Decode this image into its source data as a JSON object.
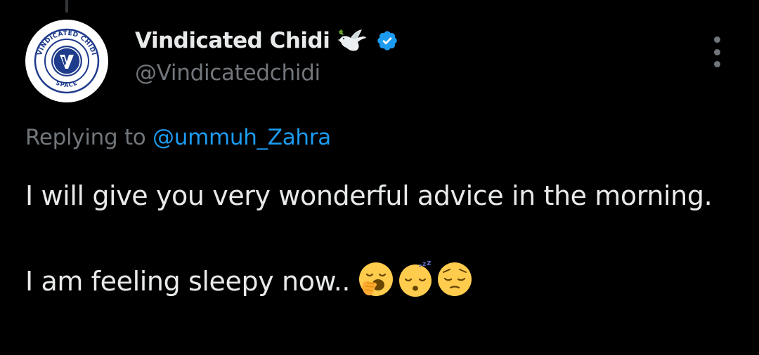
{
  "tweet": {
    "author": {
      "display_name": "Vindicated Chidi",
      "handle": "@Vindicatedchidi",
      "avatar_ring_text": "VINDICATED CHIDI SPACE",
      "avatar_letter": "V",
      "verified": true,
      "name_emoji": "dove-icon"
    },
    "reply_context": {
      "prefix": "Replying to",
      "mention": "@ummuh_Zahra"
    },
    "text": {
      "line1": "I will give you very wonderful advice in the morning.",
      "line2": "I am feeling sleepy now.."
    },
    "emojis": [
      "yawning-face-icon",
      "sleeping-face-icon",
      "pensive-face-icon"
    ]
  },
  "colors": {
    "background": "#000000",
    "primary_text": "#e7e9ea",
    "secondary_text": "#71767b",
    "accent": "#1d9bf0",
    "avatar_brand": "#1f3b8c"
  }
}
